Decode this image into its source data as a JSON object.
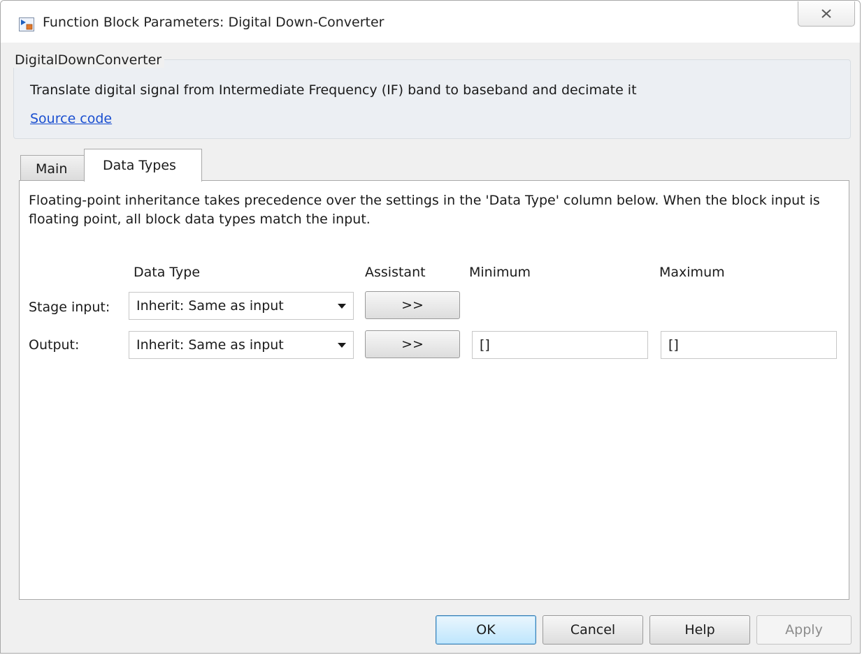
{
  "window": {
    "title": "Function Block Parameters: Digital Down-Converter",
    "icons": {
      "app": "simulink-block-icon",
      "close": "close-icon"
    }
  },
  "block": {
    "name": "DigitalDownConverter",
    "description": "Translate digital signal from Intermediate Frequency (IF) band to baseband and decimate it",
    "source_link": "Source code"
  },
  "tabs": [
    {
      "label": "Main",
      "active": false
    },
    {
      "label": "Data Types",
      "active": true
    }
  ],
  "data_types": {
    "note": "Floating-point inheritance takes precedence over the settings in the 'Data Type' column below. When the block input is floating point, all block data types match the input.",
    "columns": {
      "data_type": "Data Type",
      "assistant": "Assistant",
      "minimum": "Minimum",
      "maximum": "Maximum"
    },
    "rows": [
      {
        "label": "Stage input:",
        "data_type": "Inherit: Same as input",
        "assistant": ">>"
      },
      {
        "label": "Output:",
        "data_type": "Inherit: Same as input",
        "assistant": ">>",
        "minimum": "[]",
        "maximum": "[]"
      }
    ]
  },
  "buttons": {
    "ok": "OK",
    "cancel": "Cancel",
    "help": "Help",
    "apply": "Apply"
  },
  "colors": {
    "link": "#1a4fd0",
    "ok_accent": "#3c7fb1",
    "disabled_text": "#8c8c8c"
  }
}
